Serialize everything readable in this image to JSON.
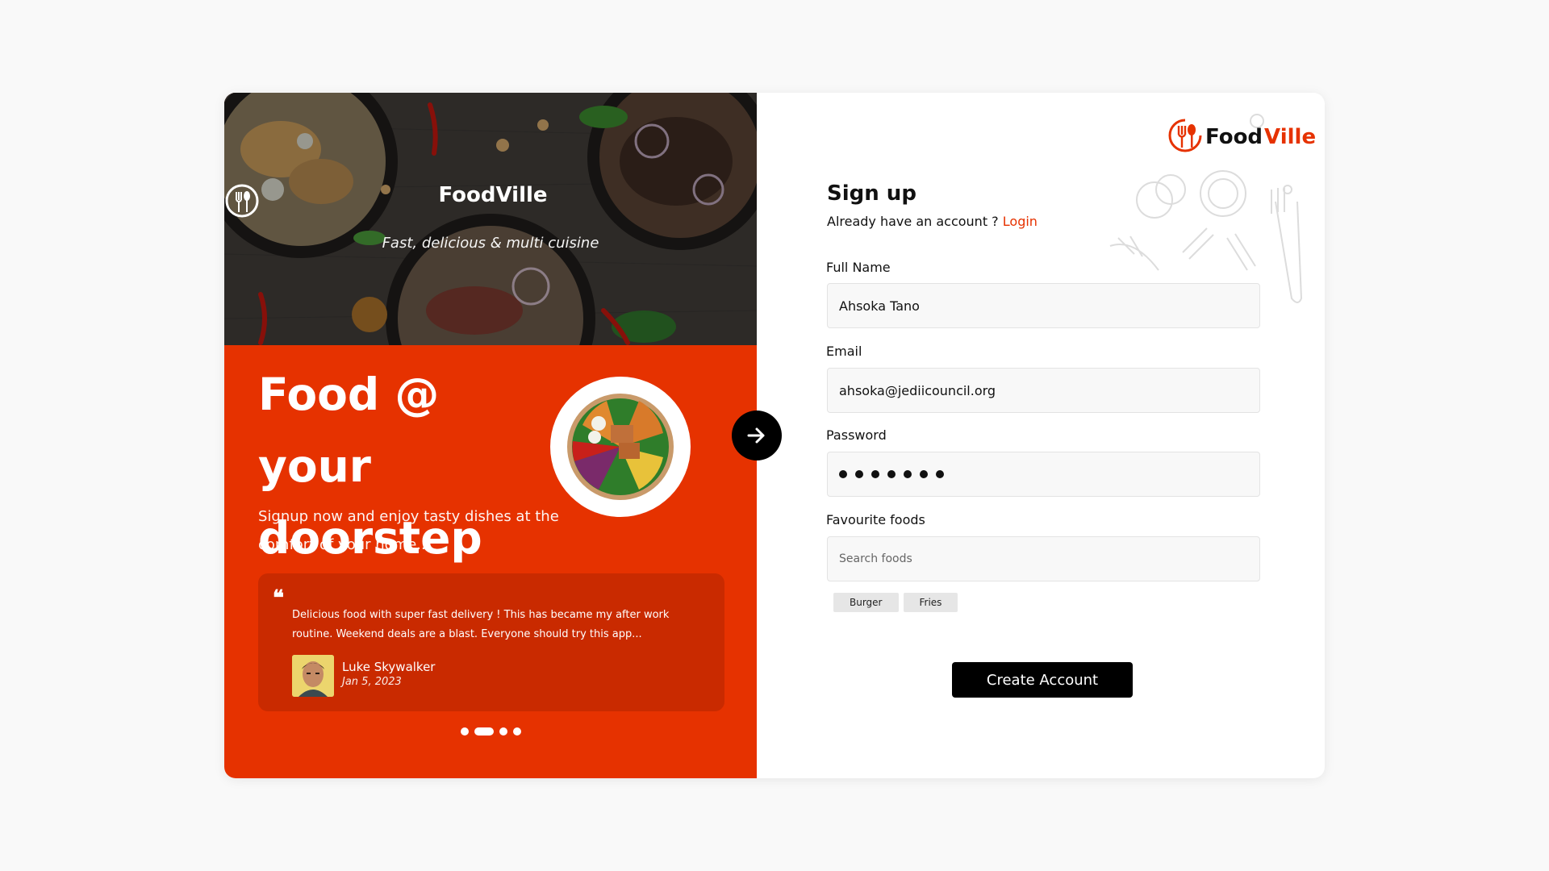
{
  "brand": {
    "name": "FoodVille",
    "name_part1": "Food",
    "name_part2": "Ville",
    "tagline": "Fast, delicious & multi cuisine",
    "accent_color": "#e63200"
  },
  "promo": {
    "headline": "Food @ your doorstep",
    "subtext": "Signup now and enjoy tasty dishes at the comfort of your home...",
    "testimonial": {
      "quote_icon": "quote-icon",
      "text": "Delicious food with super fast delivery ! This has became my after work routine. Weekend deals are a blast. Everyone should try this app...",
      "author": "Luke Skywalker",
      "date": "Jan 5, 2023"
    },
    "carousel": {
      "count": 4,
      "active_index": 1
    }
  },
  "form": {
    "title": "Sign up",
    "login_prompt": "Already have an account ?",
    "login_link": "Login",
    "full_name": {
      "label": "Full Name",
      "value": "Ahsoka Tano"
    },
    "email": {
      "label": "Email",
      "value": "ahsoka@jediicouncil.org"
    },
    "password": {
      "label": "Password",
      "masked_length": 7
    },
    "favourite_foods": {
      "label": "Favourite foods",
      "placeholder": "Search foods",
      "chips": [
        "Burger",
        "Fries"
      ]
    },
    "submit_label": "Create Account"
  }
}
